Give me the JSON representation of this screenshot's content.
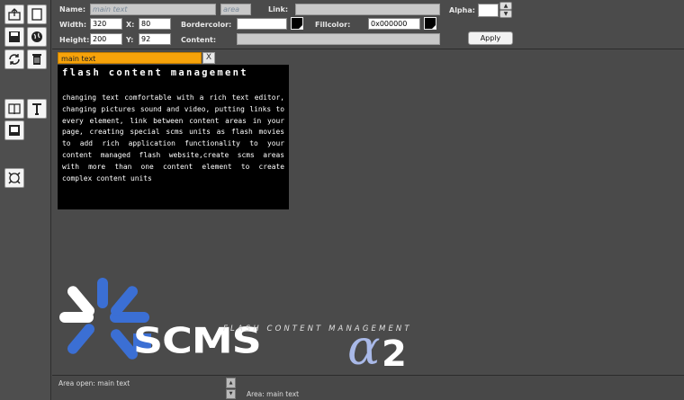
{
  "toolbar": {
    "icons": [
      "export-icon",
      "new-page-icon",
      "save-icon",
      "globe-icon",
      "refresh-icon",
      "trash-icon",
      "book-icon",
      "text-icon",
      "media-icon",
      "expand-icon"
    ]
  },
  "props": {
    "name_label": "Name:",
    "name_value": "main text",
    "area_value": "area",
    "link_label": "Link:",
    "link_value": "",
    "alpha_label": "Alpha:",
    "alpha_value": "",
    "width_label": "Width:",
    "width_value": "320",
    "x_label": "X:",
    "x_value": "80",
    "bordercolor_label": "Bordercolor:",
    "bordercolor_value": "",
    "fillcolor_label": "Fillcolor:",
    "fillcolor_value": "0x000000",
    "height_label": "Height:",
    "height_value": "200",
    "y_label": "Y:",
    "y_value": "92",
    "content_label": "Content:",
    "content_value": "",
    "apply_label": "Apply",
    "alpha_up": "▲",
    "alpha_down": "▼"
  },
  "canvas": {
    "tab_label": "main text",
    "tab_close": "X",
    "content_title": "flash content management",
    "content_body": "changing text comfortable with a rich text editor, changing pictures sound and video, putting links to every element, link between content areas in your page, creating special scms units as flash movies to add rich application functionality to your content managed flash website,create scms areas with more than one content element to create complex content units",
    "tagline": "FLASH CONTENT MANAGEMENT",
    "logo_text": "SCMS",
    "logo_alpha": "α",
    "logo_version": "2"
  },
  "colors": {
    "accent_blue": "#3b6fd4",
    "tab_orange": "#f7a30a",
    "logo_white": "#ffffff"
  },
  "status": {
    "left_text": "Area open: main text",
    "right_text": "Area: main text",
    "scroll_up": "▲",
    "scroll_down": "▼"
  }
}
